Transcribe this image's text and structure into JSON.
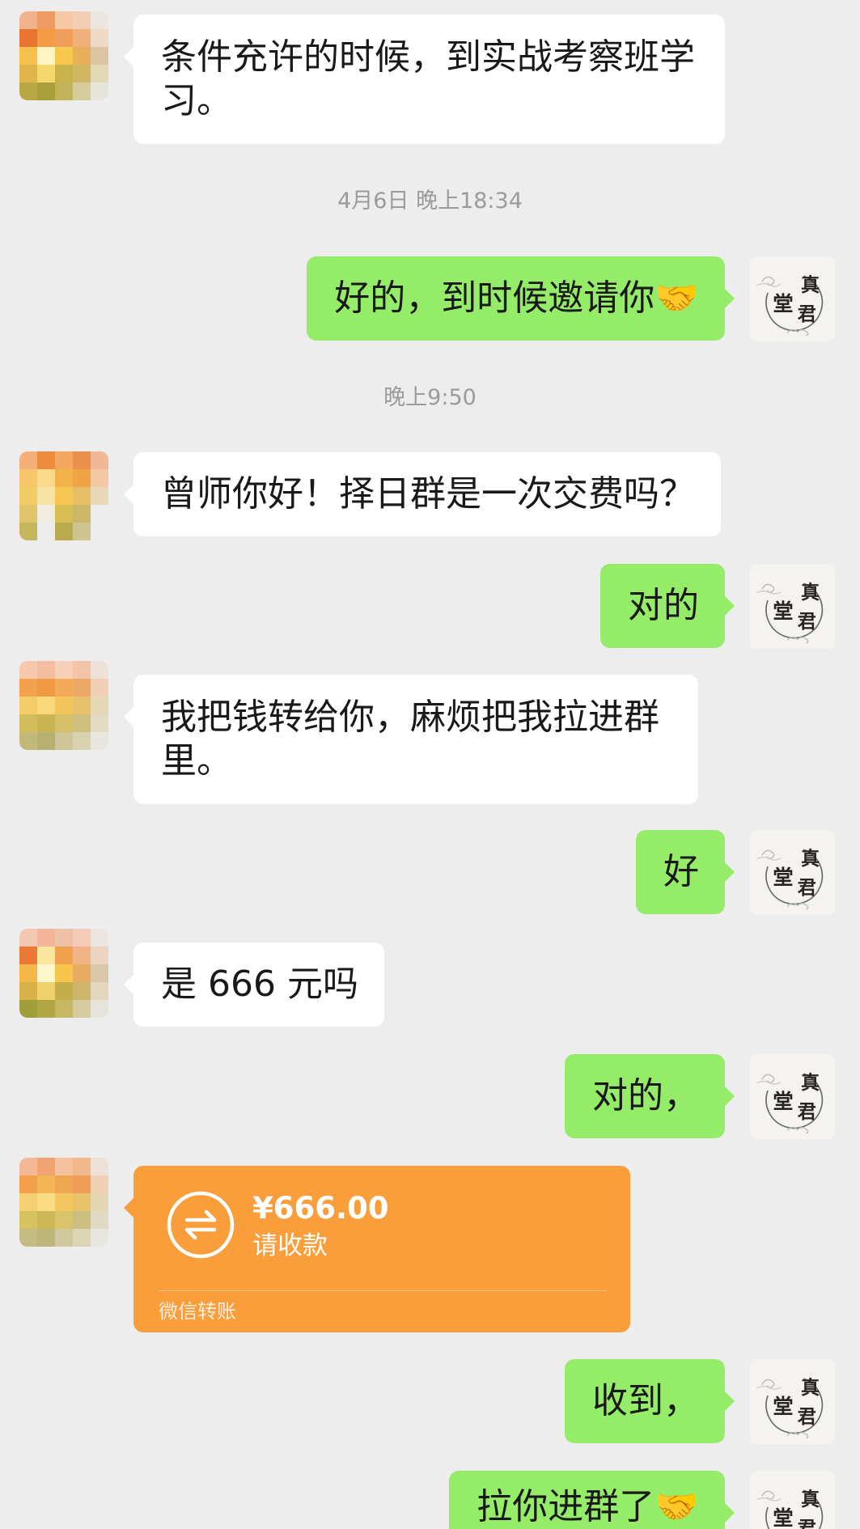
{
  "colors": {
    "background": "#ededed",
    "incoming_bubble": "#ffffff",
    "outgoing_bubble": "#95ec69",
    "transfer_card": "#fa9d3b",
    "timestamp_text": "#9b9b9b"
  },
  "my_avatar_logo": {
    "top_char": "真",
    "left_char": "堂",
    "bottom_char": "君"
  },
  "chat": {
    "items": [
      {
        "from_contact": true,
        "text": "条件充许的时候，到实战考察班学习。"
      },
      {
        "timestamp": "4月6日 晚上18:34"
      },
      {
        "from_contact": false,
        "text": "好的，到时候邀请你🤝"
      },
      {
        "timestamp": "晚上9:50"
      },
      {
        "from_contact": true,
        "text": "曾师你好！择日群是一次交费吗？"
      },
      {
        "from_contact": false,
        "text": "对的"
      },
      {
        "from_contact": true,
        "text": "我把钱转给你，麻烦把我拉进群里。"
      },
      {
        "from_contact": false,
        "text": "好"
      },
      {
        "from_contact": true,
        "text": "是 666 元吗"
      },
      {
        "from_contact": false,
        "text": "对的，"
      },
      {
        "from_contact": true,
        "transfer": {
          "icon": "transfer-arrows-icon",
          "amount": "¥666.00",
          "status": "请收款",
          "label": "微信转账"
        }
      },
      {
        "from_contact": false,
        "text": "收到，"
      },
      {
        "from_contact": false,
        "text": "拉你进群了🤝"
      }
    ]
  }
}
